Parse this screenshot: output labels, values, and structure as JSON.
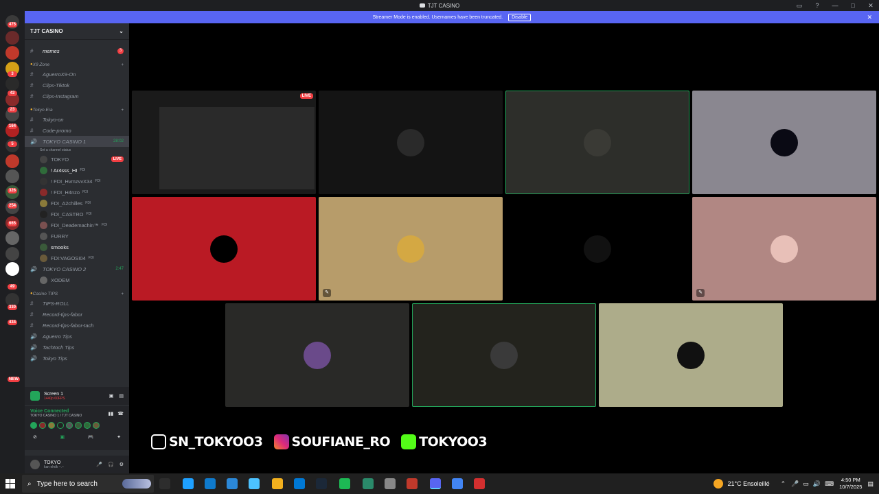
{
  "window": {
    "title": "TJT CASINO"
  },
  "banner": {
    "text": "Streamer Mode is enabled. Usernames have been truncated.",
    "button": "Disable"
  },
  "rail_badges": [
    "475",
    "3",
    "43",
    "23",
    "164",
    "5",
    "326",
    "254",
    "665",
    "49",
    "330",
    "434",
    "NEW"
  ],
  "guild": {
    "name": "TJT CASINO"
  },
  "channels": [
    {
      "kind": "text",
      "name": "memes",
      "badge": "3"
    },
    {
      "kind": "category",
      "name": "X9 Zone"
    },
    {
      "kind": "text",
      "name": "AguerroX9-On"
    },
    {
      "kind": "text",
      "name": "Clips-Tiktok"
    },
    {
      "kind": "text",
      "name": "Clips-Instagram"
    },
    {
      "kind": "category",
      "name": "Tokyo Era"
    },
    {
      "kind": "text",
      "name": "Tokyo-on"
    },
    {
      "kind": "text",
      "name": "Code-promo"
    },
    {
      "kind": "voice",
      "name": "TOKYO CASINO 1",
      "timer": "28:02",
      "status": "Set a channel status"
    }
  ],
  "voice_users": [
    {
      "name": "TOKYO",
      "tag": "LIVE"
    },
    {
      "name": "! Ar4sss_HI",
      "tag": "FDI"
    },
    {
      "name": "! FDI_HvmzvvX34",
      "tag": "FDI"
    },
    {
      "name": "! FDI_H4nzo",
      "tag": "FDI"
    },
    {
      "name": "FDI_A2chilles",
      "tag": "FDI"
    },
    {
      "name": "FDI_CASTRO",
      "tag": "FDI"
    },
    {
      "name": "FDI_Deademachin™",
      "tag": "FDI"
    },
    {
      "name": "FURRY",
      "tag": ""
    },
    {
      "name": "smooks",
      "tag": ""
    },
    {
      "name": "FDI:VAGOSI04",
      "tag": "FDI"
    }
  ],
  "voice2": {
    "name": "TOKYO CASINO 2",
    "timer": "2:47",
    "user": "XODEM"
  },
  "channels2": [
    {
      "kind": "category",
      "name": "Casino TIPS"
    },
    {
      "kind": "text",
      "name": "TIPS-ROLL"
    },
    {
      "kind": "text",
      "name": "Record-tips-fabor"
    },
    {
      "kind": "text",
      "name": "Record-tips-fabor-tach"
    },
    {
      "kind": "voice",
      "name": "Aguerro Tips"
    },
    {
      "kind": "voice",
      "name": "Tachtoch Tips"
    },
    {
      "kind": "voice",
      "name": "Tokyo Tips"
    }
  ],
  "screen": {
    "title": "Screen 1",
    "sub": "1440p 60FPS"
  },
  "voice_conn": {
    "title": "Voice Connected",
    "sub": "TOKYO CASINO 1 / TJT CASINO"
  },
  "user": {
    "name": "TOKYO",
    "status": "kan ehdk ~.~"
  },
  "tile_live": "LIVE",
  "tile_colors": [
    "#111111",
    "#141414",
    "#2d2e2a",
    "#8a8790",
    "#ba1a24",
    "#b79c6a",
    "#000000",
    "#b18783",
    "#292927",
    "#23231d",
    "#adac8a"
  ],
  "socials": [
    {
      "handle": "SN_TOKYOO3",
      "icon": "tiktok-icon"
    },
    {
      "handle": "SOUFIANE_RO",
      "icon": "instagram-icon"
    },
    {
      "handle": "TOKYOO3",
      "icon": "kick-icon"
    }
  ],
  "taskbar": {
    "search": "Type here to search",
    "weather": "21°C  Ensoleillé",
    "time": "4:50 PM",
    "date": "10/7/2025"
  }
}
